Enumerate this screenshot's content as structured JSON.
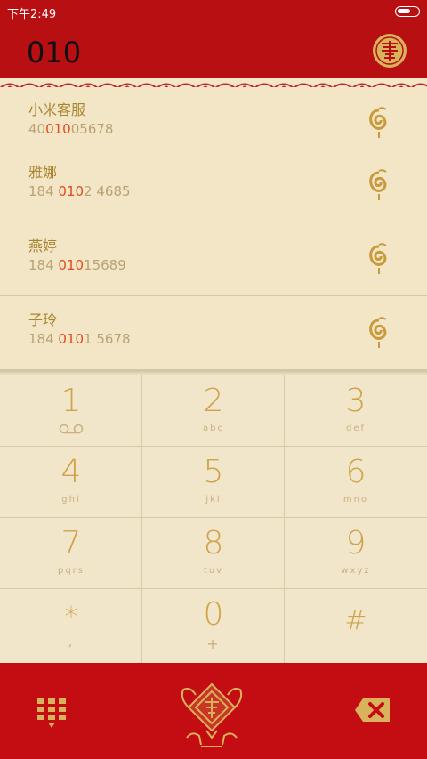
{
  "status_bar": {
    "time": "下午2:49"
  },
  "header": {
    "number": "010"
  },
  "contacts": [
    {
      "name": "小米客服",
      "number_pre": "40",
      "number_match": "010",
      "number_post": "05678"
    },
    {
      "name": "雅娜",
      "number_pre": "184 ",
      "number_match": "010",
      "number_post": "2 4685"
    },
    {
      "name": "燕婷",
      "number_pre": "184 ",
      "number_match": "010",
      "number_post": "15689"
    },
    {
      "name": "子玲",
      "number_pre": "184 ",
      "number_match": "010",
      "number_post": "1 5678"
    }
  ],
  "keys": [
    {
      "digit": "1",
      "letters": ""
    },
    {
      "digit": "2",
      "letters": "abc"
    },
    {
      "digit": "3",
      "letters": "def"
    },
    {
      "digit": "4",
      "letters": "ghi"
    },
    {
      "digit": "5",
      "letters": "jkl"
    },
    {
      "digit": "6",
      "letters": "mno"
    },
    {
      "digit": "7",
      "letters": "pqrs"
    },
    {
      "digit": "8",
      "letters": "tuv"
    },
    {
      "digit": "9",
      "letters": "wxyz"
    },
    {
      "digit": "*",
      "letters": ","
    },
    {
      "digit": "0",
      "letters": "+"
    },
    {
      "digit": "#",
      "letters": ""
    }
  ],
  "icons": {
    "voicemail": "voicemail-icon",
    "dialpad": "dialpad-grid-icon",
    "backspace": "backspace-icon",
    "emblem": "fu-goat-emblem-icon",
    "contact": "chinese-knot-icon"
  },
  "colors": {
    "header_red": "#b80f12",
    "bottom_red": "#c40d13",
    "background": "#efe4c6",
    "gold": "#cfa34b",
    "highlight": "#e24a1c"
  }
}
